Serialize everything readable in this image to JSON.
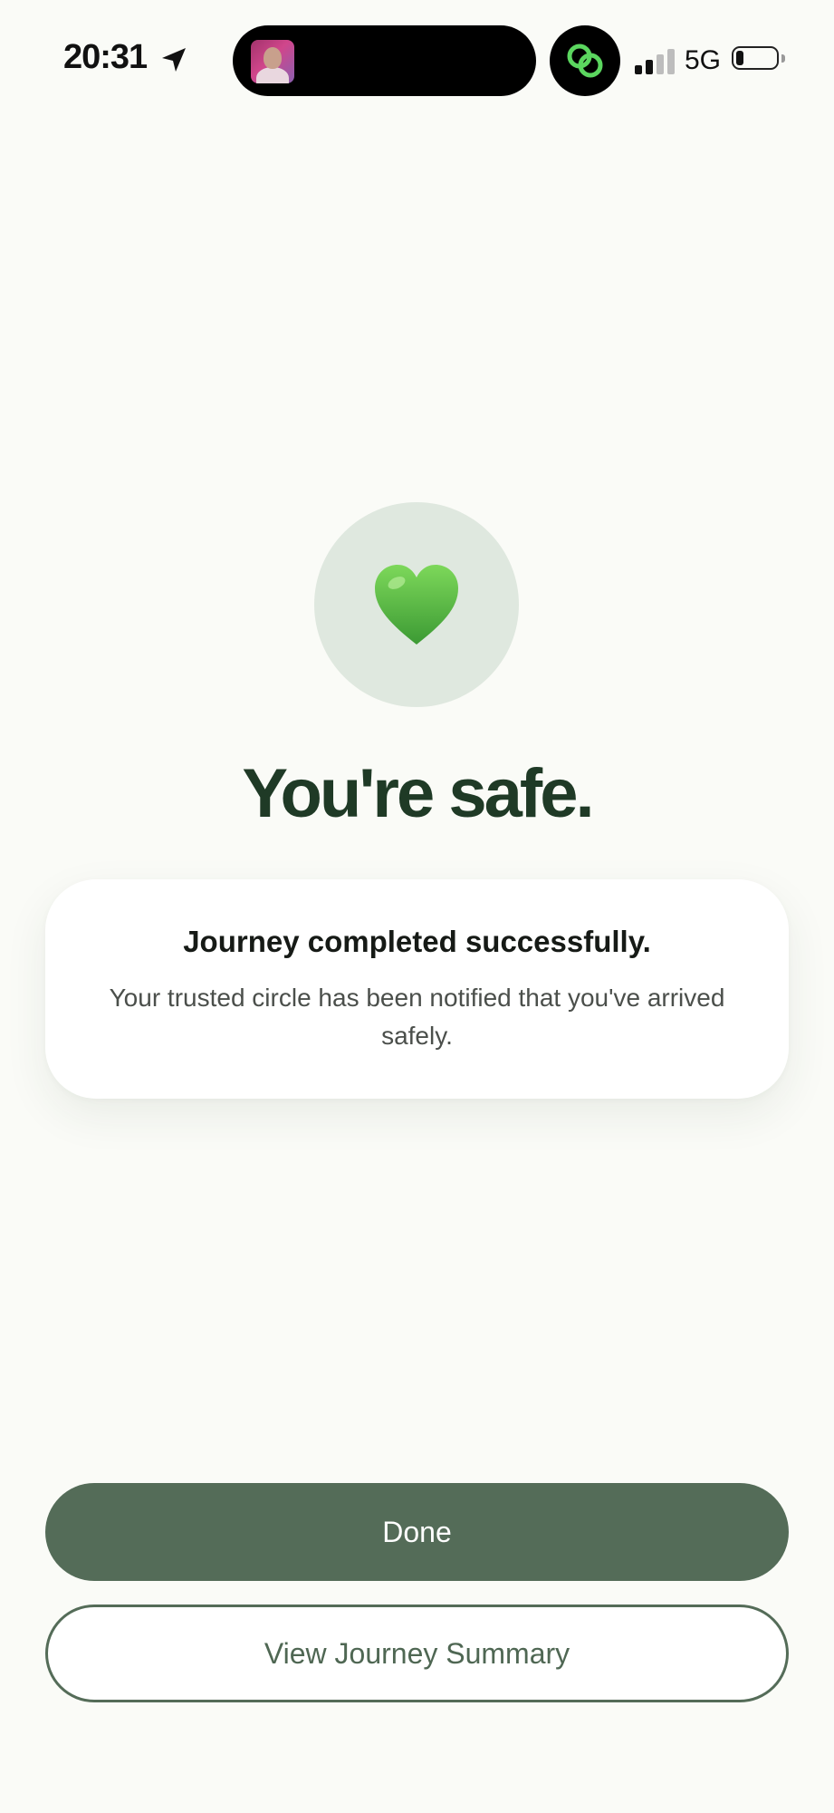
{
  "status_bar": {
    "time": "20:31",
    "network": "5G",
    "icons": [
      "location-arrow-icon",
      "signal-bars-icon",
      "battery-icon",
      "linked-rings-app-icon"
    ]
  },
  "hero": {
    "icon": "green-heart-icon",
    "headline": "You're safe."
  },
  "card": {
    "title": "Journey completed successfully.",
    "body": "Your trusted circle has been notified that you've arrived safely."
  },
  "actions": {
    "done_label": "Done",
    "summary_label": "View Journey Summary"
  },
  "colors": {
    "background": "#fafbf7",
    "primary": "#546c58",
    "headline": "#1f3a26",
    "heart": "#5cc043",
    "heart_circle": "#dfe8df",
    "app_icon_green": "#5bd65f"
  }
}
